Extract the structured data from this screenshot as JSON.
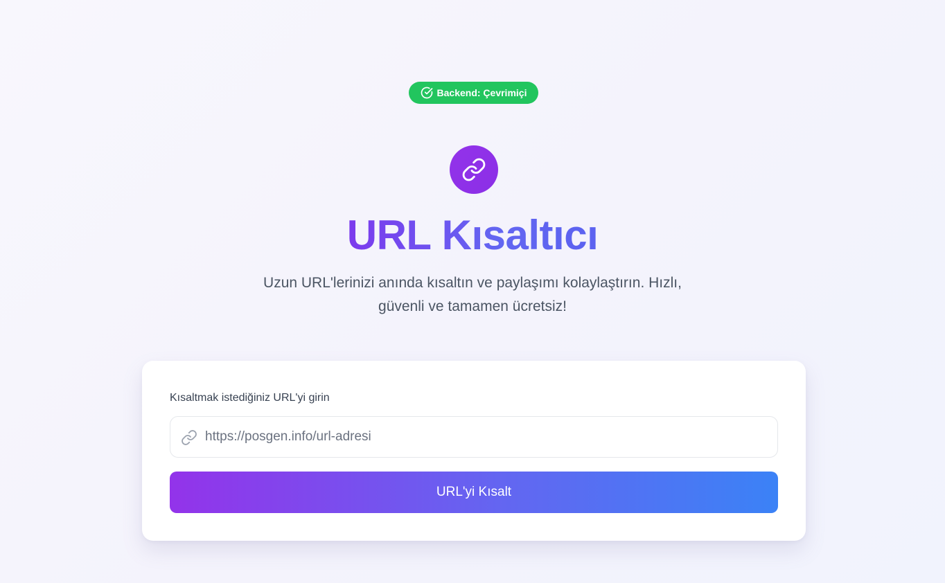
{
  "status": {
    "label": "Backend: Çevrimiçi",
    "icon": "check-circle-icon",
    "color": "#22c55e"
  },
  "hero": {
    "icon": "link-icon",
    "title": "URL Kısaltıcı",
    "subtitle_line1": "Uzun URL'lerinizi anında kısaltın ve paylaşımı kolaylaştırın. Hızlı,",
    "subtitle_line2": "güvenli ve tamamen ücretsiz!",
    "accent": "#9333ea"
  },
  "form": {
    "label": "Kısaltmak istediğiniz URL'yi girin",
    "input_placeholder": "https://posgen.info/url-adresi",
    "input_value": "",
    "input_icon": "link-icon",
    "submit_label": "URL'yi Kısalt",
    "gradient_from": "#9333ea",
    "gradient_to": "#3b82f6"
  }
}
